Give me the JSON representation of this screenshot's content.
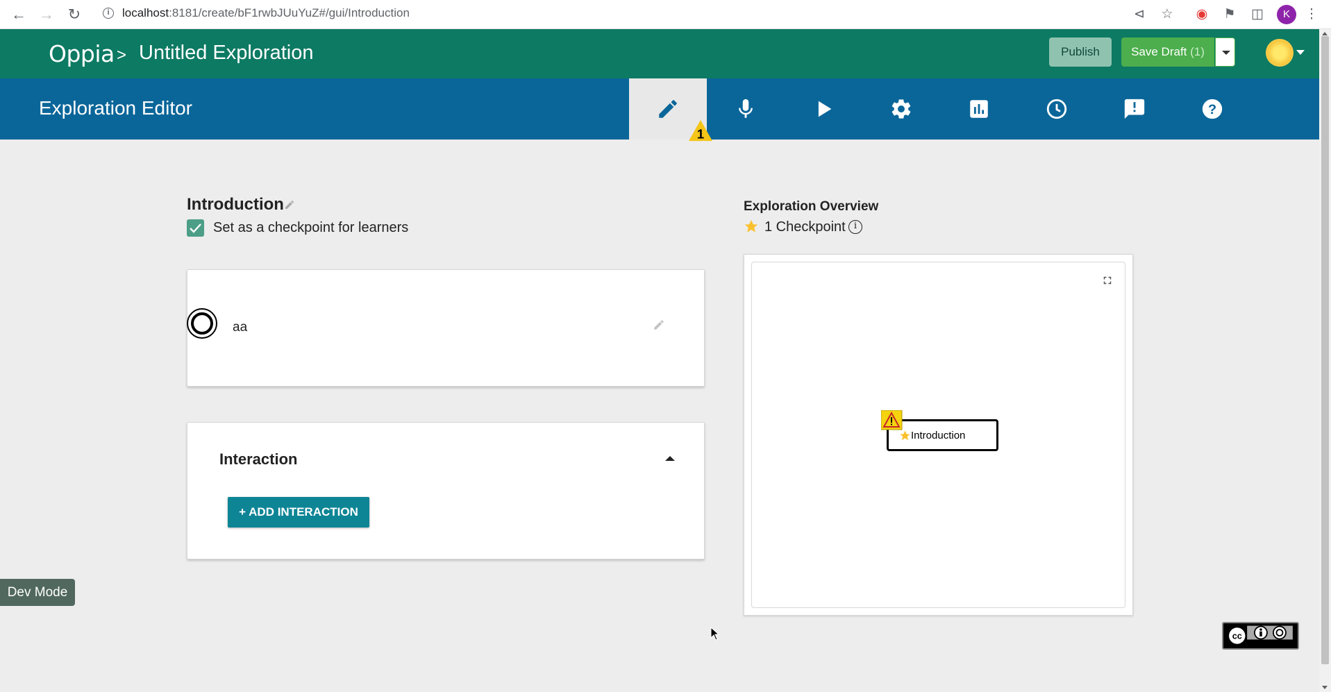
{
  "browser": {
    "url_host": "localhost",
    "url_rest": ":8181/create/bF1rwbJUuYuZ#/gui/Introduction",
    "profile_initial": "K"
  },
  "header": {
    "logo_text": "Oppia",
    "breadcrumb_sep": ">",
    "exploration_title": "Untitled Exploration",
    "publish_label": "Publish",
    "save_draft_label": "Save Draft",
    "save_draft_count": "(1)"
  },
  "editor_bar": {
    "title": "Exploration Editor",
    "tabs": [
      {
        "name": "editor",
        "icon": "pencil-icon",
        "active": true,
        "warning_count": "1"
      },
      {
        "name": "translation",
        "icon": "microphone-icon"
      },
      {
        "name": "preview",
        "icon": "play-icon"
      },
      {
        "name": "settings",
        "icon": "gear-icon"
      },
      {
        "name": "statistics",
        "icon": "bar-chart-icon"
      },
      {
        "name": "history",
        "icon": "clock-icon"
      },
      {
        "name": "feedback",
        "icon": "feedback-icon"
      },
      {
        "name": "help",
        "icon": "help-icon"
      }
    ]
  },
  "state": {
    "name": "Introduction",
    "checkpoint_label": "Set as a checkpoint for learners",
    "checkpoint_checked": true,
    "content_text": "aa"
  },
  "interaction": {
    "title": "Interaction",
    "add_button": "+ ADD INTERACTION"
  },
  "overview": {
    "title": "Exploration Overview",
    "checkpoint_count": "1 Checkpoint",
    "node_label": "Introduction"
  },
  "dev_mode_label": "Dev Mode",
  "colors": {
    "topbar": "#0d7a63",
    "editorbar": "#0a6699",
    "save_green": "#4cae4c",
    "add_interaction": "#0d8595"
  }
}
